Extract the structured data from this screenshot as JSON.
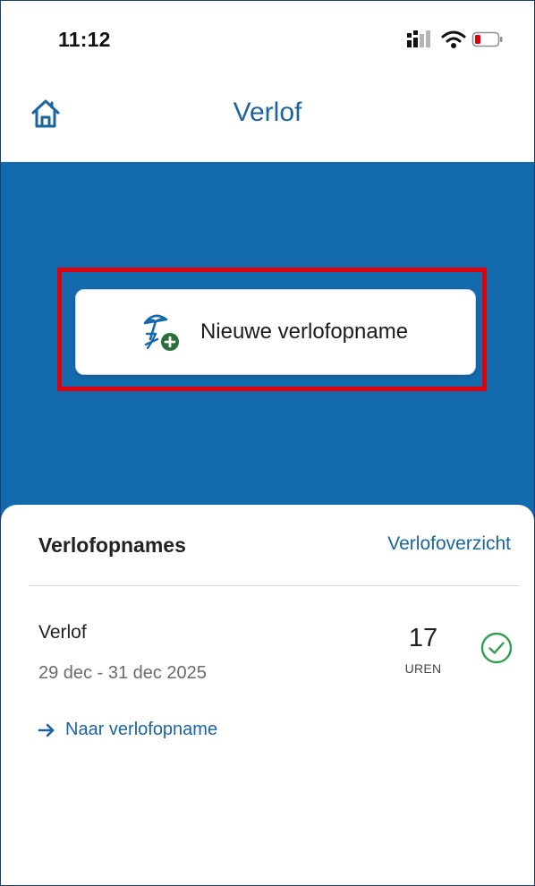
{
  "status_bar": {
    "time": "11:12",
    "icons": [
      "signal-icon",
      "wifi-icon",
      "battery-low-icon"
    ]
  },
  "nav": {
    "title": "Verlof",
    "home_icon": "home-icon"
  },
  "hero": {
    "new_leave_button_label": "Nieuwe verlofopname",
    "new_leave_icon": "beach-umbrella-add-icon"
  },
  "card": {
    "title": "Verlofopnames",
    "overview_link": "Verlofoverzicht",
    "items": [
      {
        "type": "Verlof",
        "dates": "29 dec - 31 dec 2025",
        "hours": "17",
        "unit": "UREN",
        "status_icon": "check-circle-icon",
        "link_label": "Naar verlofopname"
      }
    ]
  },
  "colors": {
    "brand_blue": "#136bad",
    "link_blue": "#1a64a0",
    "success_green": "#2e9e4f",
    "highlight_red": "#e3000b"
  }
}
